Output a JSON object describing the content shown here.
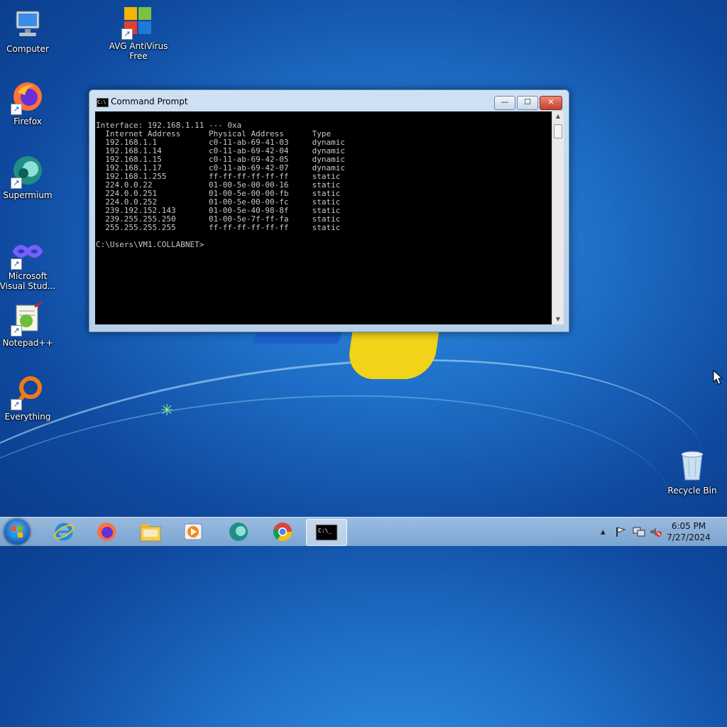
{
  "desktop": {
    "icons": [
      {
        "label": "Computer"
      },
      {
        "label": "AVG AntiVirus Free"
      },
      {
        "label": "Firefox"
      },
      {
        "label": "Supermium"
      },
      {
        "label": "Microsoft Visual Stud..."
      },
      {
        "label": "Notepad++"
      },
      {
        "label": "Everything"
      },
      {
        "label": "Recycle Bin"
      }
    ]
  },
  "window": {
    "title": "Command Prompt",
    "buttons": {
      "minimize": "—",
      "maximize": "☐",
      "close": "✕"
    },
    "console_text": "Interface: 192.168.1.11 --- 0xa\n  Internet Address      Physical Address      Type\n  192.168.1.1           c0-11-ab-69-41-03     dynamic\n  192.168.1.14          c0-11-ab-69-42-04     dynamic\n  192.168.1.15          c0-11-ab-69-42-05     dynamic\n  192.168.1.17          c0-11-ab-69-42-07     dynamic\n  192.168.1.255         ff-ff-ff-ff-ff-ff     static\n  224.0.0.22            01-00-5e-00-00-16     static\n  224.0.0.251           01-00-5e-00-00-fb     static\n  224.0.0.252           01-00-5e-00-00-fc     static\n  239.192.152.143       01-00-5e-40-98-8f     static\n  239.255.255.250       01-00-5e-7f-ff-fa     static\n  255.255.255.255       ff-ff-ff-ff-ff-ff     static\n\nC:\\Users\\VM1.COLLABNET>"
  },
  "taskbar": {
    "items": [
      "Start",
      "Internet Explorer",
      "Firefox",
      "File Explorer",
      "Media Player",
      "Supermium",
      "Chrome",
      "Command Prompt"
    ],
    "clock": {
      "time": "6:05 PM",
      "date": "7/27/2024"
    }
  }
}
